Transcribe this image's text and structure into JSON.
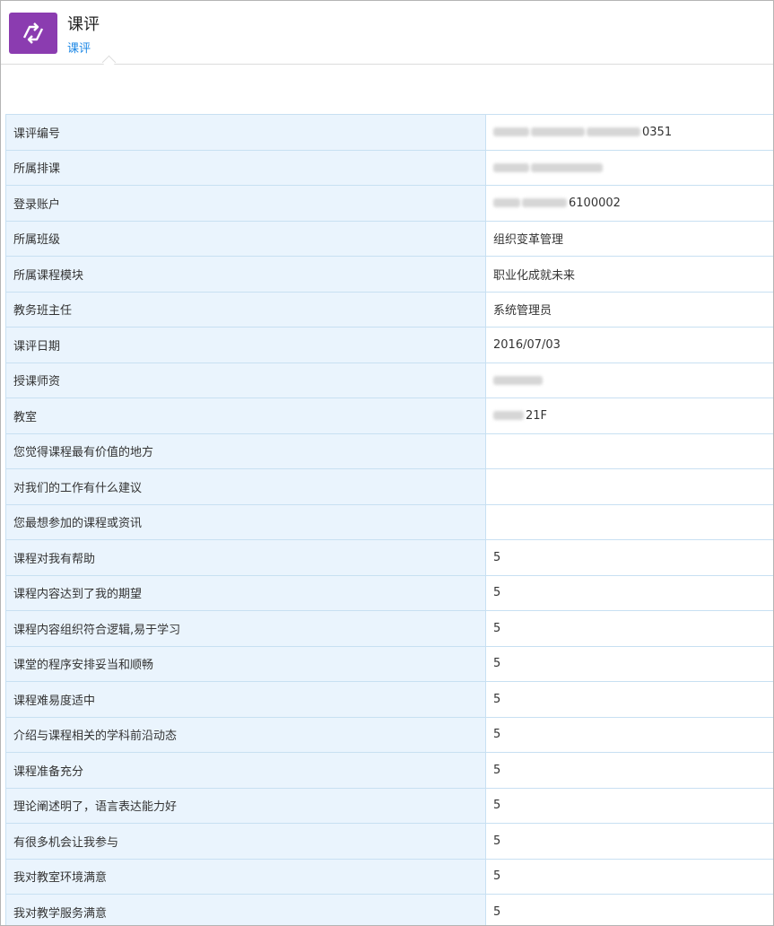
{
  "header": {
    "app_title": "课评",
    "tab_label": "课评",
    "icon_color": "#8b3cb0"
  },
  "rows": [
    {
      "label": "课评编号",
      "value": "0351"
    },
    {
      "label": "所属排课",
      "value": ""
    },
    {
      "label": "登录账户",
      "value": "6100002"
    },
    {
      "label": "所属班级",
      "value": "组织变革管理"
    },
    {
      "label": "所属课程模块",
      "value": "职业化成就未来"
    },
    {
      "label": "教务班主任",
      "value": "系统管理员"
    },
    {
      "label": "课评日期",
      "value": "2016/07/03"
    },
    {
      "label": "授课师资",
      "value": ""
    },
    {
      "label": "教室",
      "value": "21F"
    },
    {
      "label": "您觉得课程最有价值的地方",
      "value": ""
    },
    {
      "label": "对我们的工作有什么建议",
      "value": ""
    },
    {
      "label": "您最想参加的课程或资讯",
      "value": ""
    },
    {
      "label": "课程对我有帮助",
      "value": "5"
    },
    {
      "label": "课程内容达到了我的期望",
      "value": "5"
    },
    {
      "label": "课程内容组织符合逻辑,易于学习",
      "value": "5"
    },
    {
      "label": "课堂的程序安排妥当和顺畅",
      "value": "5"
    },
    {
      "label": "课程难易度适中",
      "value": "5"
    },
    {
      "label": "介绍与课程相关的学科前沿动态",
      "value": "5"
    },
    {
      "label": "课程准备充分",
      "value": "5"
    },
    {
      "label": "理论阐述明了，语言表达能力好",
      "value": "5"
    },
    {
      "label": "有很多机会让我参与",
      "value": "5"
    },
    {
      "label": "我对教室环境满意",
      "value": "5"
    },
    {
      "label": "我对教学服务满意",
      "value": "5"
    }
  ]
}
